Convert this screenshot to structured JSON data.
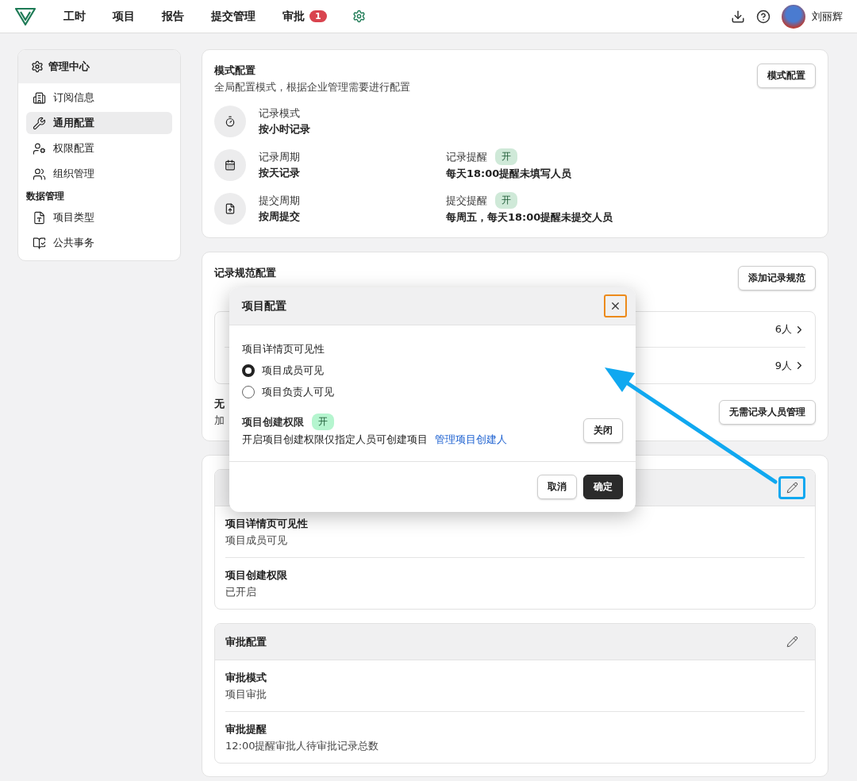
{
  "nav": {
    "items": [
      {
        "label": "工时"
      },
      {
        "label": "项目"
      },
      {
        "label": "报告"
      },
      {
        "label": "提交管理"
      },
      {
        "label": "审批",
        "badge": "1"
      }
    ],
    "user": "刘丽辉"
  },
  "sidebar": {
    "title": "管理中心",
    "items": [
      {
        "kind": "item",
        "label": "订阅信息",
        "selected": false
      },
      {
        "kind": "item",
        "label": "通用配置",
        "selected": true
      },
      {
        "kind": "item",
        "label": "权限配置",
        "selected": false
      },
      {
        "kind": "item",
        "label": "组织管理",
        "selected": false
      },
      {
        "kind": "section",
        "label": "数据管理"
      },
      {
        "kind": "item",
        "label": "项目类型",
        "selected": false
      },
      {
        "kind": "item",
        "label": "公共事务",
        "selected": false
      }
    ]
  },
  "mode_card": {
    "title": "模式配置",
    "description": "全局配置模式，根据企业管理需要进行配置",
    "button": "模式配置",
    "rows": [
      {
        "label": "记录模式",
        "value": "按小时记录"
      },
      {
        "label": "记录周期",
        "value": "按天记录",
        "reminder": {
          "label": "记录提醒",
          "status": "开",
          "value": "每天18:00提醒未填写人员"
        }
      },
      {
        "label": "提交周期",
        "value": "按周提交",
        "reminder": {
          "label": "提交提醒",
          "status": "开",
          "value": "每周五，每天18:00提醒未提交人员"
        }
      }
    ]
  },
  "rule_card": {
    "title": "记录规范配置",
    "button": "添加记录规范",
    "groups": [
      {
        "count": "6人"
      },
      {
        "count": "9人"
      }
    ],
    "exempt": {
      "title": "无",
      "description": "加",
      "button": "无需记录人员管理"
    }
  },
  "config_sections": [
    {
      "items": [
        {
          "label": "项目详情页可见性",
          "value": "项目成员可见"
        },
        {
          "label": "项目创建权限",
          "value": "已开启"
        }
      ]
    },
    {
      "title": "审批配置",
      "items": [
        {
          "label": "审批模式",
          "value": "项目审批"
        },
        {
          "label": "审批提醒",
          "value": "12:00提醒审批人待审批记录总数"
        }
      ]
    }
  ],
  "dialog": {
    "title": "项目配置",
    "visibility_label": "项目详情页可见性",
    "options": [
      {
        "label": "项目成员可见",
        "selected": true
      },
      {
        "label": "项目负责人可见",
        "selected": false
      }
    ],
    "permission": {
      "label": "项目创建权限",
      "on": true,
      "status": "开",
      "description": "开启项目创建权限仅指定人员可创建项目",
      "link": "管理项目创建人",
      "toggle_button": "关闭"
    },
    "cancel": "取消",
    "confirm": "确定"
  }
}
